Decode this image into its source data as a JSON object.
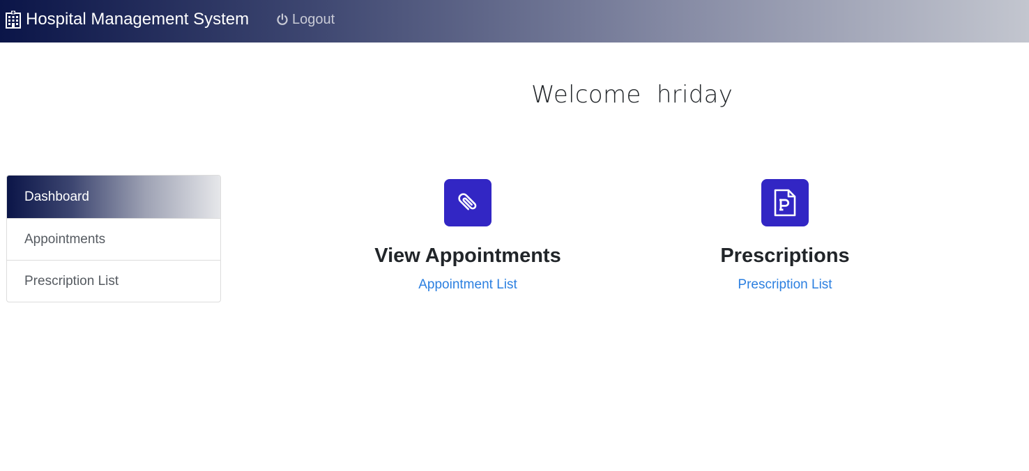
{
  "navbar": {
    "brand": "Hospital Management System",
    "brand_icon": "hospital-icon",
    "logout": "Logout",
    "logout_icon": "power-icon"
  },
  "welcome": {
    "greeting": "Welcome  hriday"
  },
  "sidebar": {
    "items": [
      {
        "label": "Dashboard",
        "active": true
      },
      {
        "label": "Appointments",
        "active": false
      },
      {
        "label": "Prescription List",
        "active": false
      }
    ]
  },
  "cards": [
    {
      "title": "View Appointments",
      "link": "Appointment List",
      "icon": "paperclip-icon"
    },
    {
      "title": "Prescriptions",
      "link": "Prescription List",
      "icon": "prescription-file-icon"
    }
  ],
  "colors": {
    "navbar_start": "#0b1548",
    "navbar_end": "#c3c6cf",
    "icon_box": "#3226c4",
    "link": "#2b7fe0"
  }
}
